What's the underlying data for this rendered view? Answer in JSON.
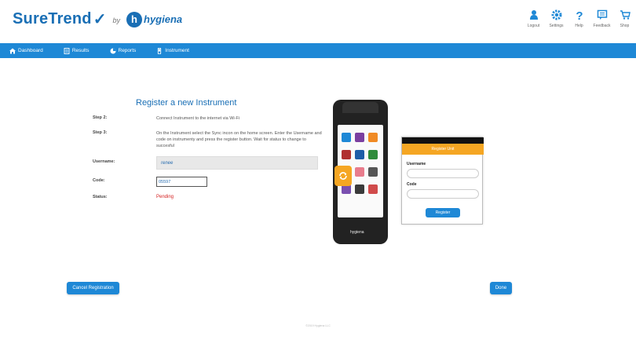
{
  "brand": {
    "name": "SureTrend",
    "by": "by",
    "partner": "hygiena"
  },
  "top_actions": [
    {
      "label": "Logout",
      "icon": "user-icon"
    },
    {
      "label": "Settings",
      "icon": "gear-icon"
    },
    {
      "label": "Help",
      "icon": "question-icon"
    },
    {
      "label": "Feedback",
      "icon": "feedback-icon"
    },
    {
      "label": "Shop",
      "icon": "cart-icon"
    }
  ],
  "nav": [
    {
      "label": "Dashboard",
      "icon": "home-icon"
    },
    {
      "label": "Results",
      "icon": "document-icon"
    },
    {
      "label": "Reports",
      "icon": "pie-icon"
    },
    {
      "label": "Instrument",
      "icon": "device-icon"
    }
  ],
  "page": {
    "title": "Register a new Instrument",
    "step2_label": "Step 2:",
    "step2_text": "Connect Instrument to the internet via Wi-Fi",
    "step3_label": "Step 3:",
    "step3_text": "On the Instrument select the Sync incon on the home screen. Enter the Username and code on instrumenty and press the register button. Wait for status to change to succesful",
    "username_label": "Username:",
    "username_value": "renee",
    "code_label": "Code:",
    "code_value": "05597",
    "status_label": "Status:",
    "status_value": "Pending"
  },
  "device": {
    "brand": "hygiena",
    "callout_title": "Register Unit",
    "callout_username": "Username",
    "callout_code": "Code",
    "callout_button": "Register"
  },
  "buttons": {
    "cancel": "Cancel Registration",
    "done": "Done"
  },
  "footer": "©2019 Hygiena LLC",
  "colors": {
    "primary": "#1e88d6",
    "brand": "#1a6fb5",
    "status_pending": "#d42020",
    "accent": "#f5a623"
  }
}
